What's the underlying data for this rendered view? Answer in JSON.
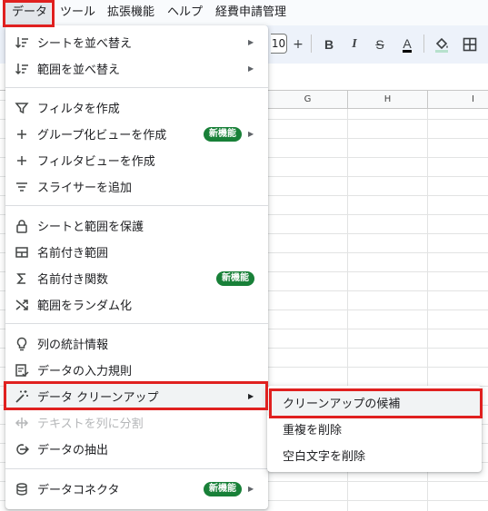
{
  "menubar": {
    "items": [
      {
        "label": "データ"
      },
      {
        "label": "ツール"
      },
      {
        "label": "拡張機能"
      },
      {
        "label": "ヘルプ"
      },
      {
        "label": "経費申請管理"
      }
    ]
  },
  "toolbar": {
    "font_size": "10",
    "plus": "+",
    "bold": "B",
    "italic": "I",
    "strike": "S",
    "text_color": "A"
  },
  "sheet": {
    "columns": [
      "G",
      "H",
      "I"
    ]
  },
  "data_menu": {
    "items": [
      {
        "label": "シートを並べ替え",
        "icon": "sort-icon",
        "submenu": true
      },
      {
        "label": "範囲を並べ替え",
        "icon": "sort-icon",
        "submenu": true
      },
      {
        "label": "フィルタを作成",
        "icon": "filter-icon"
      },
      {
        "label": "グループ化ビューを作成",
        "icon": "plus-icon",
        "badge": "新機能",
        "submenu": true
      },
      {
        "label": "フィルタビューを作成",
        "icon": "plus-icon"
      },
      {
        "label": "スライサーを追加",
        "icon": "slicer-icon"
      },
      {
        "label": "シートと範囲を保護",
        "icon": "lock-icon"
      },
      {
        "label": "名前付き範囲",
        "icon": "named-range-icon"
      },
      {
        "label": "名前付き関数",
        "icon": "sigma-icon",
        "badge": "新機能"
      },
      {
        "label": "範囲をランダム化",
        "icon": "shuffle-icon"
      },
      {
        "label": "列の統計情報",
        "icon": "lightbulb-icon"
      },
      {
        "label": "データの入力規則",
        "icon": "validation-icon"
      },
      {
        "label": "データ クリーンアップ",
        "icon": "magic-wand-icon",
        "submenu": true
      },
      {
        "label": "テキストを列に分割",
        "icon": "split-icon",
        "disabled": true
      },
      {
        "label": "データの抽出",
        "icon": "extract-icon"
      },
      {
        "label": "データコネクタ",
        "icon": "database-icon",
        "badge": "新機能",
        "submenu": true
      }
    ]
  },
  "cleanup_submenu": {
    "items": [
      {
        "label": "クリーンアップの候補"
      },
      {
        "label": "重複を削除"
      },
      {
        "label": "空白文字を削除"
      }
    ]
  },
  "colors": {
    "highlight": "#e0201f",
    "badge": "#188038"
  }
}
